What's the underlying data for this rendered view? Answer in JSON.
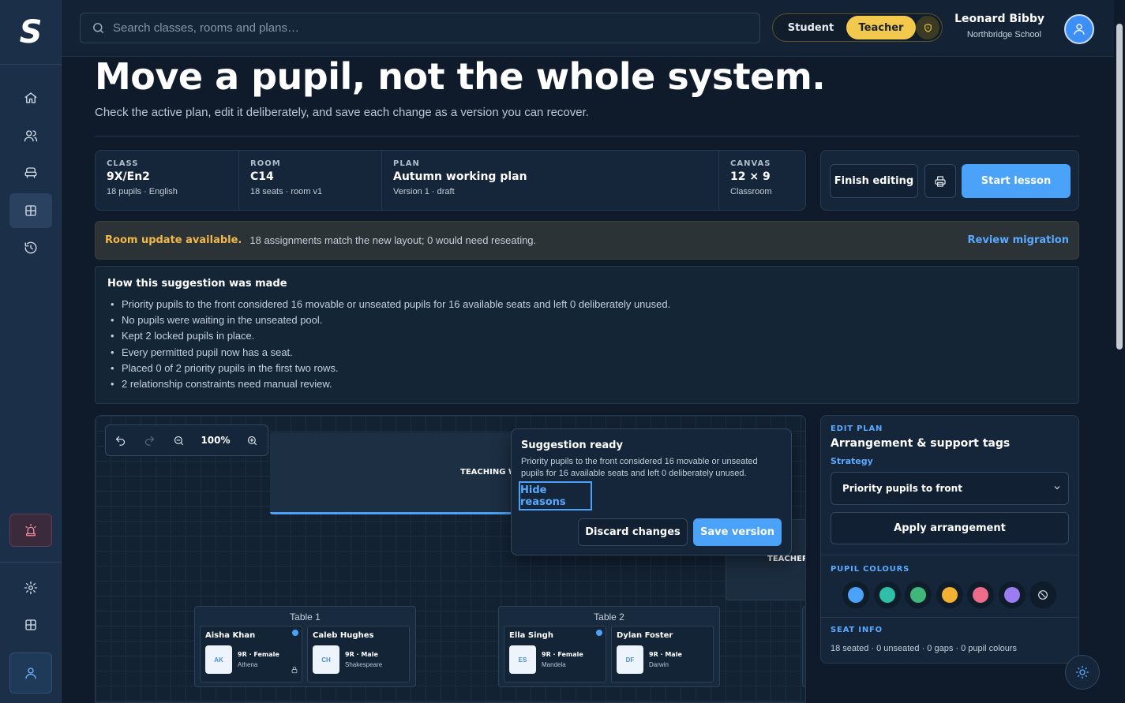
{
  "app": {
    "logo": "S"
  },
  "search": {
    "placeholder": "Search classes, rooms and plans…"
  },
  "role_switch": {
    "student": "Student",
    "teacher": "Teacher",
    "active": "Teacher"
  },
  "user": {
    "name": "Leonard Bibby",
    "school": "Northbridge School"
  },
  "sidebar": {
    "items": [
      {
        "icon": "home-icon"
      },
      {
        "icon": "users-icon"
      },
      {
        "icon": "seat-icon"
      },
      {
        "icon": "grid-icon",
        "active": true
      },
      {
        "icon": "history-icon"
      }
    ],
    "alarm_icon": "alarm-icon",
    "bottom_items": [
      {
        "icon": "gear-icon"
      },
      {
        "icon": "grid-icon"
      },
      {
        "icon": "user-icon"
      }
    ]
  },
  "hero": {
    "title": "Move a pupil, not the whole system.",
    "subtitle": "Check the active plan, edit it deliberately, and save each change as a version you can recover."
  },
  "info": {
    "class": {
      "label": "CLASS",
      "value": "9X/En2",
      "meta": "18 pupils · English"
    },
    "room": {
      "label": "ROOM",
      "value": "C14",
      "meta": "18 seats · room v1"
    },
    "plan": {
      "label": "PLAN",
      "value": "Autumn working plan",
      "meta": "Version 1 · draft"
    },
    "canvas": {
      "label": "CANVAS",
      "value": "12 × 9",
      "meta": "Classroom"
    }
  },
  "actions": {
    "finish": "Finish editing",
    "start": "Start lesson"
  },
  "banner": {
    "title": "Room update available.",
    "text": "18 assignments match the new layout; 0 would need reseating.",
    "link": "Review migration"
  },
  "reasons": {
    "title": "How this suggestion was made",
    "items": [
      "Priority pupils to the front considered 16 movable or unseated pupils for 16 available seats and left 0 deliberately unused.",
      "No pupils were waiting in the unseated pool.",
      "Kept 2 locked pupils in place.",
      "Every permitted pupil now has a seat.",
      "Placed 0 of 2 priority pupils in the first two rows.",
      "2 relationship constraints need manual review."
    ]
  },
  "canvas_view": {
    "zoom": "100%",
    "teaching_wall": "TEACHING W",
    "teacher": "TEACHER",
    "tables": [
      {
        "label": "Table 1",
        "seats": [
          {
            "name": "Aisha Khan",
            "initials": "AK",
            "meta": "9R · Female",
            "house": "Athena",
            "priority_dot": true,
            "locked": true
          },
          {
            "name": "Caleb Hughes",
            "initials": "CH",
            "meta": "9R · Male",
            "house": "Shakespeare",
            "priority_dot": false,
            "locked": false
          }
        ]
      },
      {
        "label": "Table 2",
        "seats": [
          {
            "name": "Ella Singh",
            "initials": "ES",
            "meta": "9R · Female",
            "house": "Mandela",
            "priority_dot": true,
            "locked": false
          },
          {
            "name": "Dylan Foster",
            "initials": "DF",
            "meta": "9R · Male",
            "house": "Darwin",
            "priority_dot": false,
            "locked": false
          }
        ]
      }
    ]
  },
  "popover": {
    "title": "Suggestion ready",
    "text": "Priority pupils to the front considered 16 movable or unseated pupils for 16 available seats and left 0 deliberately unused.",
    "hide": "Hide reasons",
    "discard": "Discard changes",
    "save": "Save version"
  },
  "panel": {
    "kicker": "EDIT PLAN",
    "title": "Arrangement & support tags",
    "strategy_label": "Strategy",
    "strategy_value": "Priority pupils to front",
    "apply": "Apply arrangement",
    "colours_label": "PUPIL COLOURS",
    "colours": [
      "#4aa3f8",
      "#2fbfa8",
      "#3fb67a",
      "#f2b132",
      "#ef6b8a",
      "#9b7cf2"
    ],
    "seat_info_label": "SEAT INFO",
    "seat_info": "18 seated · 0 unseated · 0 gaps · 0 pupil colours"
  }
}
